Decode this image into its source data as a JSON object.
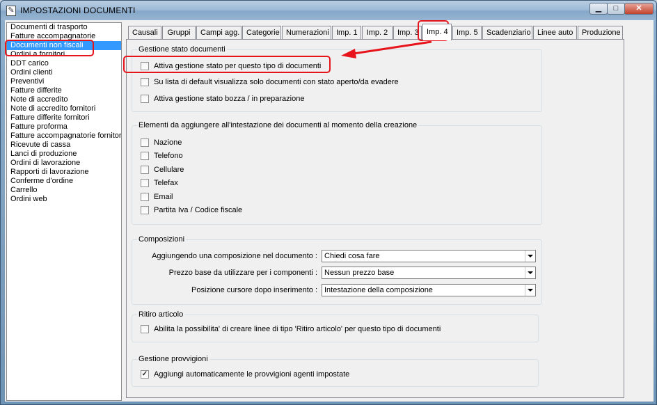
{
  "window": {
    "title": "IMPOSTAZIONI DOCUMENTI"
  },
  "doc_types": [
    "Documenti di trasporto",
    "Fatture accompagnatorie",
    "Documenti non fiscali",
    "Ordini a fornitori",
    "DDT carico",
    "Ordini clienti",
    "Preventivi",
    "Fatture differite",
    "Note di accredito",
    "Note di accredito fornitori",
    "Fatture differite fornitori",
    "Fatture proforma",
    "Fatture accompagnatorie fornitori",
    "Ricevute di cassa",
    "Lanci di produzione",
    "Ordini di lavorazione",
    "Rapporti di lavorazione",
    "Conferme d'ordine",
    "Carrello",
    "Ordini web"
  ],
  "selected_doc_type": "Documenti non fiscali",
  "tabs": [
    "Causali",
    "Gruppi",
    "Campi agg.",
    "Categorie",
    "Numerazioni",
    "Imp. 1",
    "Imp. 2",
    "Imp. 3",
    "Imp. 4",
    "Imp. 5",
    "Scadenziario",
    "Linee auto",
    "Produzione"
  ],
  "active_tab": "Imp. 4",
  "gestione_stato": {
    "title": "Gestione stato documenti",
    "options": [
      {
        "label": "Attiva gestione stato per questo tipo di documenti",
        "checked": false
      },
      {
        "label": "Su lista di default visualizza solo documenti con stato aperto/da evadere",
        "checked": false
      },
      {
        "label": "Attiva gestione stato bozza / in preparazione",
        "checked": false
      }
    ]
  },
  "intestazione": {
    "title": "Elementi da aggiungere all'intestazione dei documenti al momento della creazione",
    "options": [
      {
        "label": "Nazione",
        "checked": false
      },
      {
        "label": "Telefono",
        "checked": false
      },
      {
        "label": "Cellulare",
        "checked": false
      },
      {
        "label": "Telefax",
        "checked": false
      },
      {
        "label": "Email",
        "checked": false
      },
      {
        "label": "Partita Iva / Codice fiscale",
        "checked": false
      }
    ]
  },
  "composizioni": {
    "title": "Composizioni",
    "fields": [
      {
        "label": "Aggiungendo una composizione nel documento :",
        "value": "Chiedi cosa fare"
      },
      {
        "label": "Prezzo base da utilizzare per i componenti :",
        "value": "Nessun prezzo base"
      },
      {
        "label": "Posizione cursore dopo inserimento :",
        "value": "Intestazione della composizione"
      }
    ]
  },
  "ritiro": {
    "title": "Ritiro articolo",
    "option": {
      "label": "Abilita la possibilita' di creare linee di tipo 'Ritiro articolo' per questo tipo di documenti",
      "checked": false
    }
  },
  "provvigioni": {
    "title": "Gestione provvigioni",
    "option": {
      "label": "Aggiungi automaticamente le provvigioni agenti impostate",
      "checked": true
    }
  },
  "colors": {
    "selection": "#3399ff",
    "annotation": "#e8141c"
  }
}
